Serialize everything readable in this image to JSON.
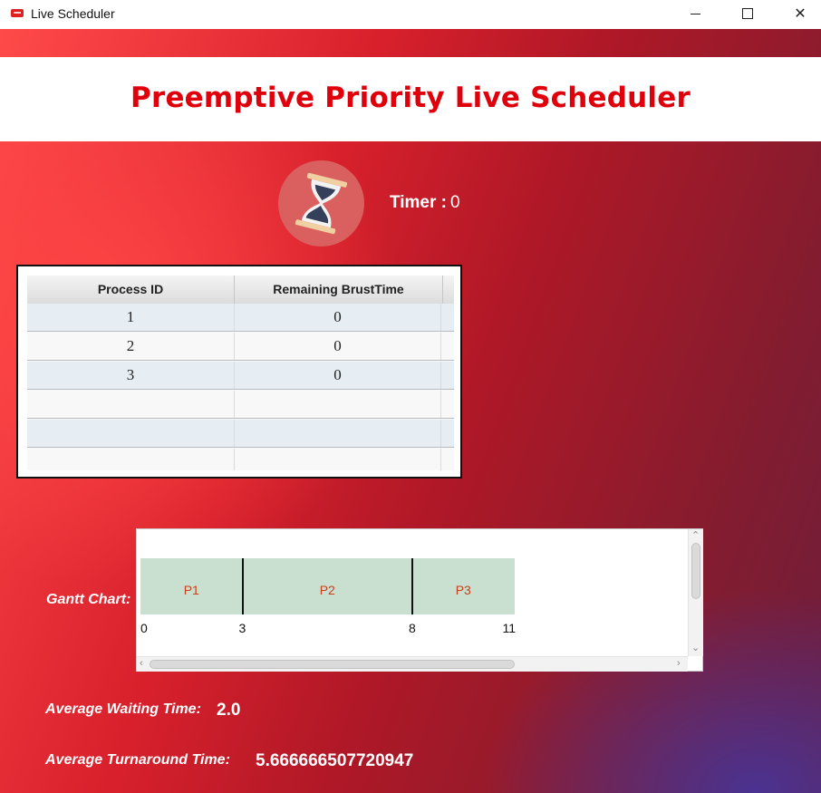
{
  "window": {
    "title": "Live Scheduler",
    "minimize_glyph": "",
    "maximize_glyph": "",
    "close_glyph": "✕"
  },
  "header": {
    "title": "Preemptive Priority Live Scheduler"
  },
  "timer": {
    "label": "Timer :",
    "value": "0"
  },
  "table": {
    "columns": [
      "Process ID",
      "Remaining BrustTime"
    ],
    "rows": [
      {
        "pid": "1",
        "remaining": "0"
      },
      {
        "pid": "2",
        "remaining": "0"
      },
      {
        "pid": "3",
        "remaining": "0"
      },
      {
        "pid": "",
        "remaining": ""
      },
      {
        "pid": "",
        "remaining": ""
      },
      {
        "pid": "",
        "remaining": ""
      }
    ]
  },
  "gantt": {
    "label": "Gantt Chart:",
    "blocks": [
      {
        "name": "P1",
        "start": 0,
        "end": 3
      },
      {
        "name": "P2",
        "start": 3,
        "end": 8
      },
      {
        "name": "P3",
        "start": 8,
        "end": 11
      }
    ],
    "ticks": [
      "0",
      "3",
      "8",
      "11"
    ]
  },
  "stats": {
    "avg_waiting_label": "Average Waiting Time:",
    "avg_waiting_value": "2.0",
    "avg_turnaround_label": "Average Turnaround Time:",
    "avg_turnaround_value": "5.666666507720947"
  },
  "colors": {
    "title_red": "#e0000c",
    "gantt_bar": "#c9e0d1",
    "gantt_text": "#c7401a"
  },
  "icons": {
    "app": "app-logo-icon",
    "timer": "hourglass-icon"
  }
}
